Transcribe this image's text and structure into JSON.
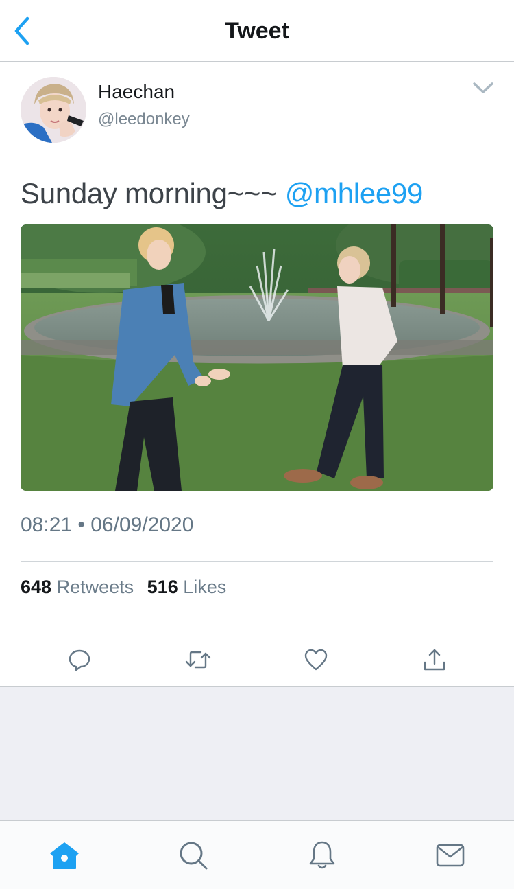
{
  "header": {
    "title": "Tweet",
    "back_icon": "chevron-left-icon"
  },
  "tweet": {
    "author": {
      "display_name": "Haechan",
      "handle": "@leedonkey"
    },
    "text_prefix": "Sunday morning~~~ ",
    "mention": "@mhlee99",
    "timestamp": "08:21 • 06/09/2020",
    "stats": {
      "retweets_count": "648",
      "retweets_label": "Retweets",
      "likes_count": "516",
      "likes_label": "Likes"
    }
  },
  "actions": [
    "reply-icon",
    "retweet-icon",
    "like-icon",
    "share-icon"
  ],
  "tab_bar": [
    "home-icon",
    "search-icon",
    "notifications-icon",
    "messages-icon"
  ],
  "colors": {
    "accent": "#1da1f2",
    "icon_gray": "#657786",
    "text": "#14171a",
    "background_gray": "#eeeff4"
  }
}
